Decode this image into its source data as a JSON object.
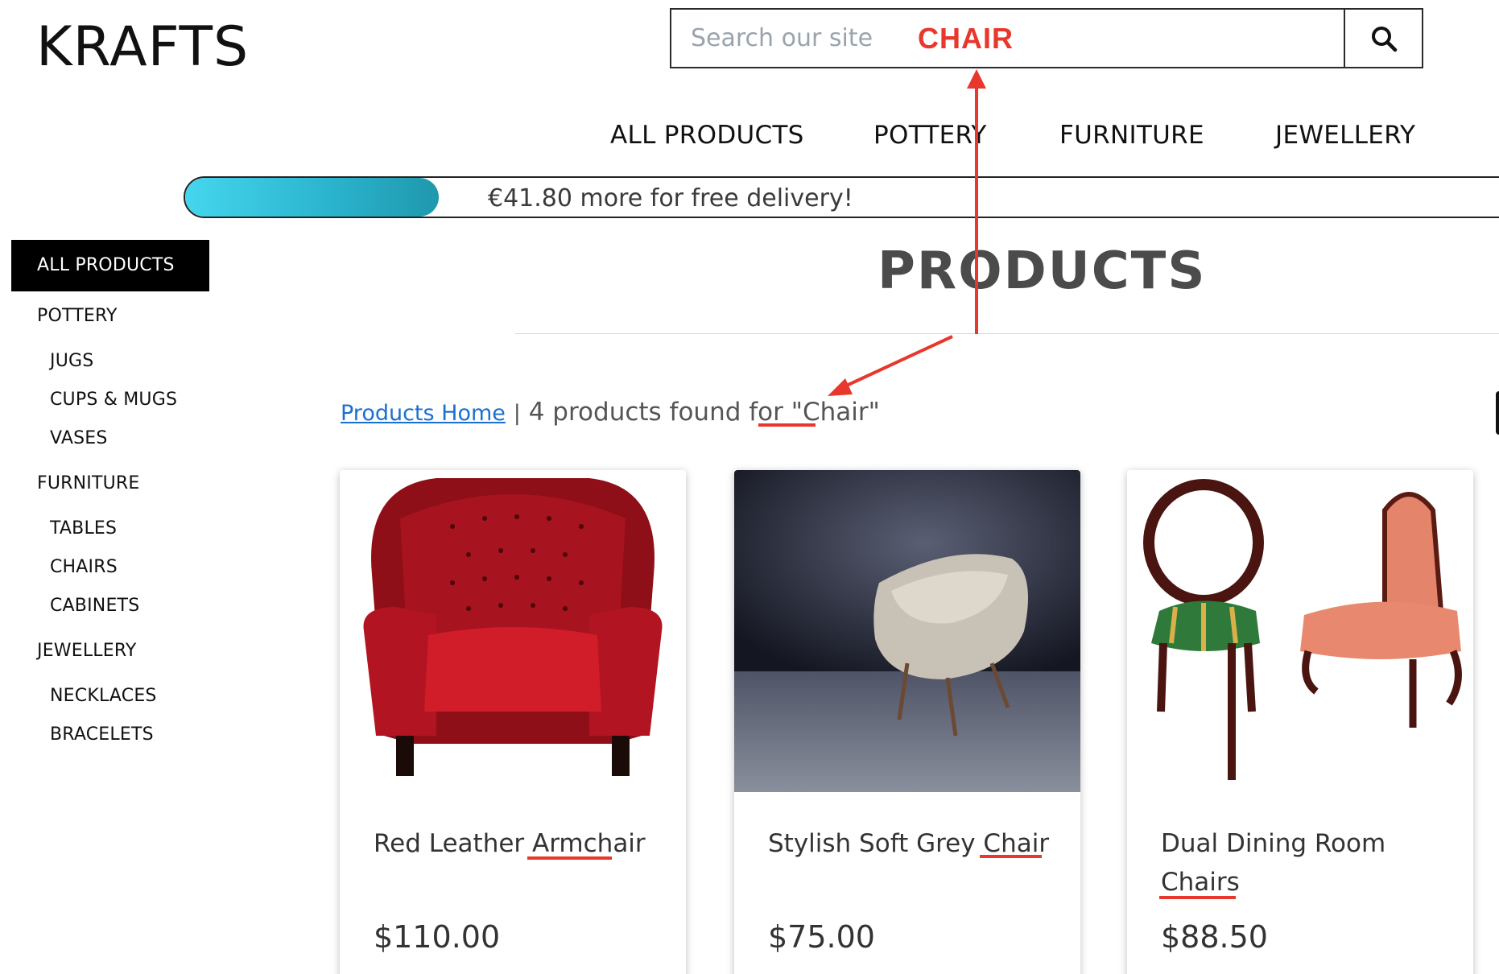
{
  "brand": {
    "logo": "KRAFTS"
  },
  "search": {
    "placeholder": "Search our site",
    "annotation": "CHAIR"
  },
  "top_nav": [
    "ALL PRODUCTS",
    "POTTERY",
    "FURNITURE",
    "JEWELLERY"
  ],
  "delivery_bar": {
    "text": "€41.80 more for free delivery!",
    "progress_percent": 19
  },
  "sidebar": {
    "active": "ALL PRODUCTS",
    "categories": [
      {
        "label": "POTTERY",
        "children": [
          "JUGS",
          "CUPS & MUGS",
          "VASES"
        ]
      },
      {
        "label": "FURNITURE",
        "children": [
          "TABLES",
          "CHAIRS",
          "CABINETS"
        ]
      },
      {
        "label": "JEWELLERY",
        "children": [
          "NECKLACES",
          "BRACELETS"
        ]
      }
    ]
  },
  "page": {
    "title": "PRODUCTS",
    "breadcrumb_home": "Products Home",
    "separator": "|",
    "results_text": "4 products found for",
    "search_term": "\"Chair\""
  },
  "products": [
    {
      "name": "Red Leather Armchair",
      "price": "$110.00"
    },
    {
      "name": "Stylish Soft Grey Chair",
      "price": "$75.00"
    },
    {
      "name": "Dual Dining Room Chairs",
      "price": "$88.50"
    }
  ],
  "colors": {
    "accent_link": "#1b6fd2",
    "annotation_red": "#e8372c",
    "progress_start": "#45d6ee",
    "progress_end": "#1f98ad"
  },
  "icons": {
    "search_button": "search-icon"
  }
}
